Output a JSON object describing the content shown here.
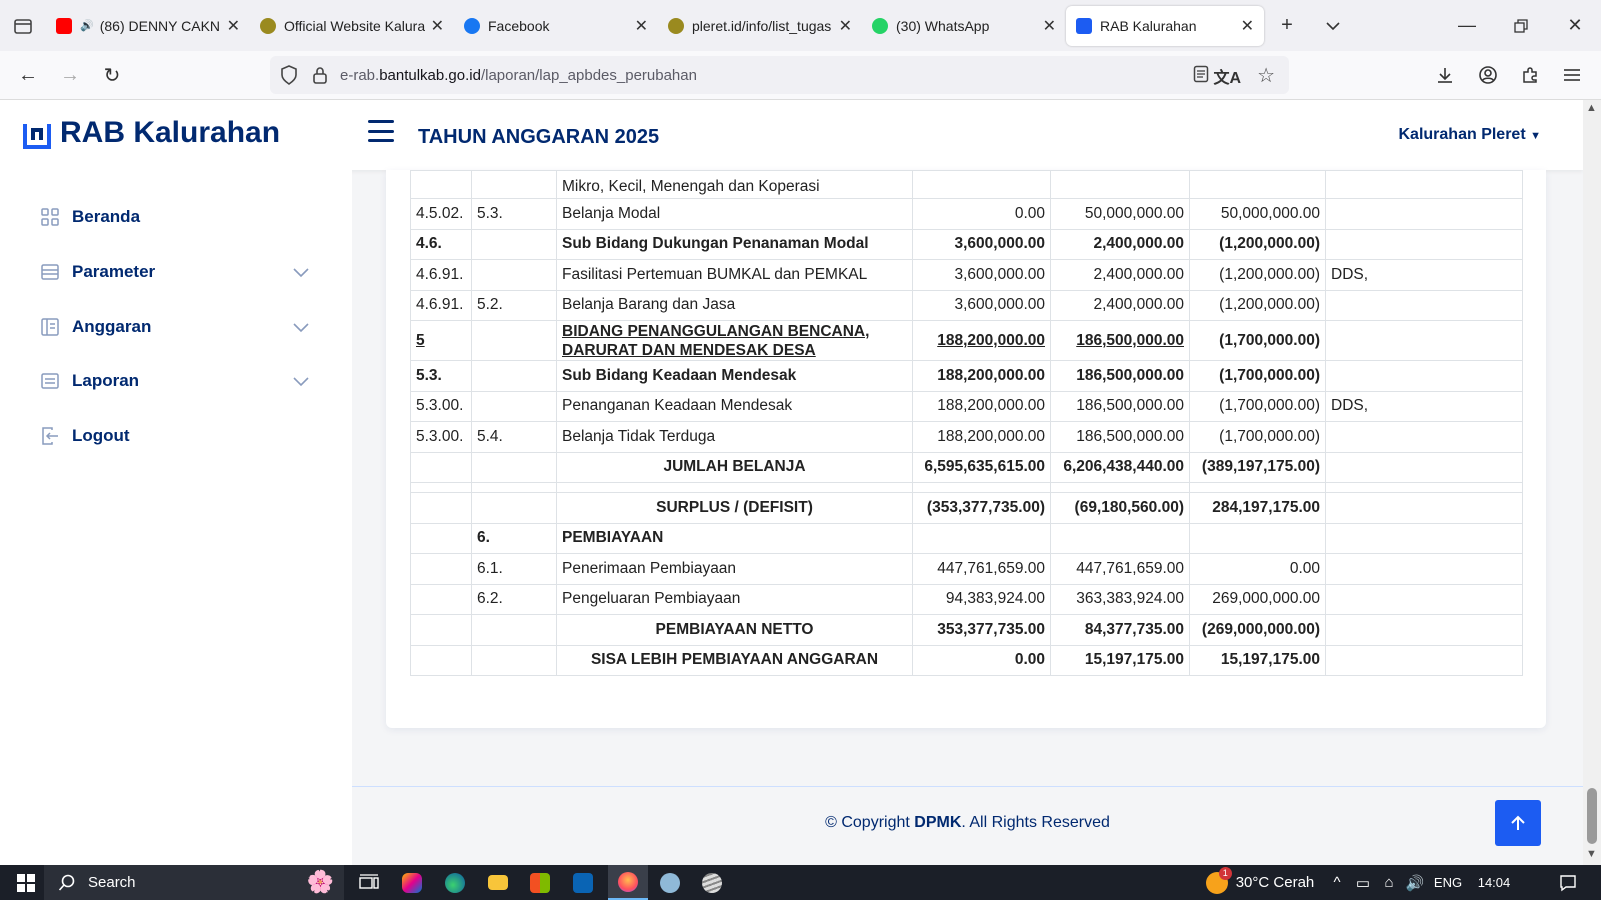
{
  "browser": {
    "tabs": [
      {
        "title": "(86) DENNY CAKN",
        "favicon": "youtube-icon",
        "audio": true
      },
      {
        "title": "Official Website Kalura",
        "favicon": "bantul-crest-icon"
      },
      {
        "title": "Facebook",
        "favicon": "facebook-icon"
      },
      {
        "title": "pleret.id/info/list_tugas",
        "favicon": "bantul-crest-icon"
      },
      {
        "title": "(30) WhatsApp",
        "favicon": "whatsapp-icon"
      },
      {
        "title": "RAB Kalurahan",
        "favicon": "rab-logo-icon",
        "active": true
      }
    ],
    "url_prefix": "e-rab.",
    "url_domain": "bantulkab.go.id",
    "url_path": "/laporan/lap_apbdes_perubahan"
  },
  "header": {
    "logo_text": "RAB Kalurahan",
    "year_title": "TAHUN ANGGARAN 2025",
    "user_menu": "Kalurahan Pleret"
  },
  "sidebar": {
    "items": [
      {
        "label": "Beranda",
        "icon": "grid-icon",
        "expandable": false
      },
      {
        "label": "Parameter",
        "icon": "layout-icon",
        "expandable": true
      },
      {
        "label": "Anggaran",
        "icon": "layout-text-icon",
        "expandable": true
      },
      {
        "label": "Laporan",
        "icon": "card-list-icon",
        "expandable": true
      },
      {
        "label": "Logout",
        "icon": "logout-icon",
        "expandable": false
      }
    ]
  },
  "table": {
    "rows": [
      {
        "kode1": "",
        "kode2": "",
        "uraian": "Mikro, Kecil, Menengah dan Koperasi",
        "a": "",
        "b": "",
        "c": "",
        "sumber": "",
        "style": "top"
      },
      {
        "kode1": "4.5.02.",
        "kode2": "5.3.",
        "uraian": "Belanja Modal",
        "a": "0.00",
        "b": "50,000,000.00",
        "c": "50,000,000.00",
        "sumber": ""
      },
      {
        "kode1": "4.6.",
        "kode2": "",
        "uraian": "Sub Bidang Dukungan Penanaman Modal",
        "a": "3,600,000.00",
        "b": "2,400,000.00",
        "c": "(1,200,000.00)",
        "sumber": "",
        "style": "bold"
      },
      {
        "kode1": "4.6.91.",
        "kode2": "",
        "uraian": "Fasilitasi Pertemuan BUMKAL dan PEMKAL",
        "a": "3,600,000.00",
        "b": "2,400,000.00",
        "c": "(1,200,000.00)",
        "sumber": "DDS,"
      },
      {
        "kode1": "4.6.91.",
        "kode2": "5.2.",
        "uraian": "Belanja Barang dan Jasa",
        "a": "3,600,000.00",
        "b": "2,400,000.00",
        "c": "(1,200,000.00)",
        "sumber": ""
      },
      {
        "kode1": "5",
        "kode2": "",
        "uraian": "BIDANG PENANGGULANGAN BENCANA, DARURAT DAN MENDESAK DESA",
        "a": "188,200,000.00",
        "b": "186,500,000.00",
        "c": "(1,700,000.00)",
        "sumber": "",
        "style": "bidang"
      },
      {
        "kode1": "5.3.",
        "kode2": "",
        "uraian": "Sub Bidang Keadaan Mendesak",
        "a": "188,200,000.00",
        "b": "186,500,000.00",
        "c": "(1,700,000.00)",
        "sumber": "",
        "style": "bold"
      },
      {
        "kode1": "5.3.00.",
        "kode2": "",
        "uraian": "Penanganan Keadaan Mendesak",
        "a": "188,200,000.00",
        "b": "186,500,000.00",
        "c": "(1,700,000.00)",
        "sumber": "DDS,"
      },
      {
        "kode1": "5.3.00.",
        "kode2": "5.4.",
        "uraian": "Belanja Tidak Terduga",
        "a": "188,200,000.00",
        "b": "186,500,000.00",
        "c": "(1,700,000.00)",
        "sumber": ""
      },
      {
        "kode1": "",
        "kode2": "",
        "uraian": "JUMLAH BELANJA",
        "a": "6,595,635,615.00",
        "b": "6,206,438,440.00",
        "c": "(389,197,175.00)",
        "sumber": "",
        "style": "total"
      },
      {
        "kode1": "",
        "kode2": "",
        "uraian": "",
        "a": "",
        "b": "",
        "c": "",
        "sumber": "",
        "style": "spacer"
      },
      {
        "kode1": "",
        "kode2": "",
        "uraian": "SURPLUS / (DEFISIT)",
        "a": "(353,377,735.00)",
        "b": "(69,180,560.00)",
        "c": "284,197,175.00",
        "sumber": "",
        "style": "total"
      },
      {
        "kode1": "",
        "kode2": "6.",
        "uraian": "PEMBIAYAAN",
        "a": "",
        "b": "",
        "c": "",
        "sumber": "",
        "style": "bold"
      },
      {
        "kode1": "",
        "kode2": "6.1.",
        "uraian": "Penerimaan Pembiayaan",
        "a": "447,761,659.00",
        "b": "447,761,659.00",
        "c": "0.00",
        "sumber": ""
      },
      {
        "kode1": "",
        "kode2": "6.2.",
        "uraian": "Pengeluaran Pembiayaan",
        "a": "94,383,924.00",
        "b": "363,383,924.00",
        "c": "269,000,000.00",
        "sumber": ""
      },
      {
        "kode1": "",
        "kode2": "",
        "uraian": "PEMBIAYAAN NETTO",
        "a": "353,377,735.00",
        "b": "84,377,735.00",
        "c": "(269,000,000.00)",
        "sumber": "",
        "style": "total"
      },
      {
        "kode1": "",
        "kode2": "",
        "uraian": "SISA LEBIH PEMBIAYAAN ANGGARAN",
        "a": "0.00",
        "b": "15,197,175.00",
        "c": "15,197,175.00",
        "sumber": "",
        "style": "total"
      }
    ]
  },
  "footer": {
    "copyright_prefix": "© Copyright ",
    "brand": "DPMK",
    "suffix": ". All Rights Reserved"
  },
  "taskbar": {
    "search_placeholder": "Search",
    "weather": "30°C Cerah",
    "weather_badge": "1",
    "language": "ENG",
    "time": "14:04"
  },
  "colors": {
    "brand": "#012970",
    "accent": "#1c5cf2"
  }
}
